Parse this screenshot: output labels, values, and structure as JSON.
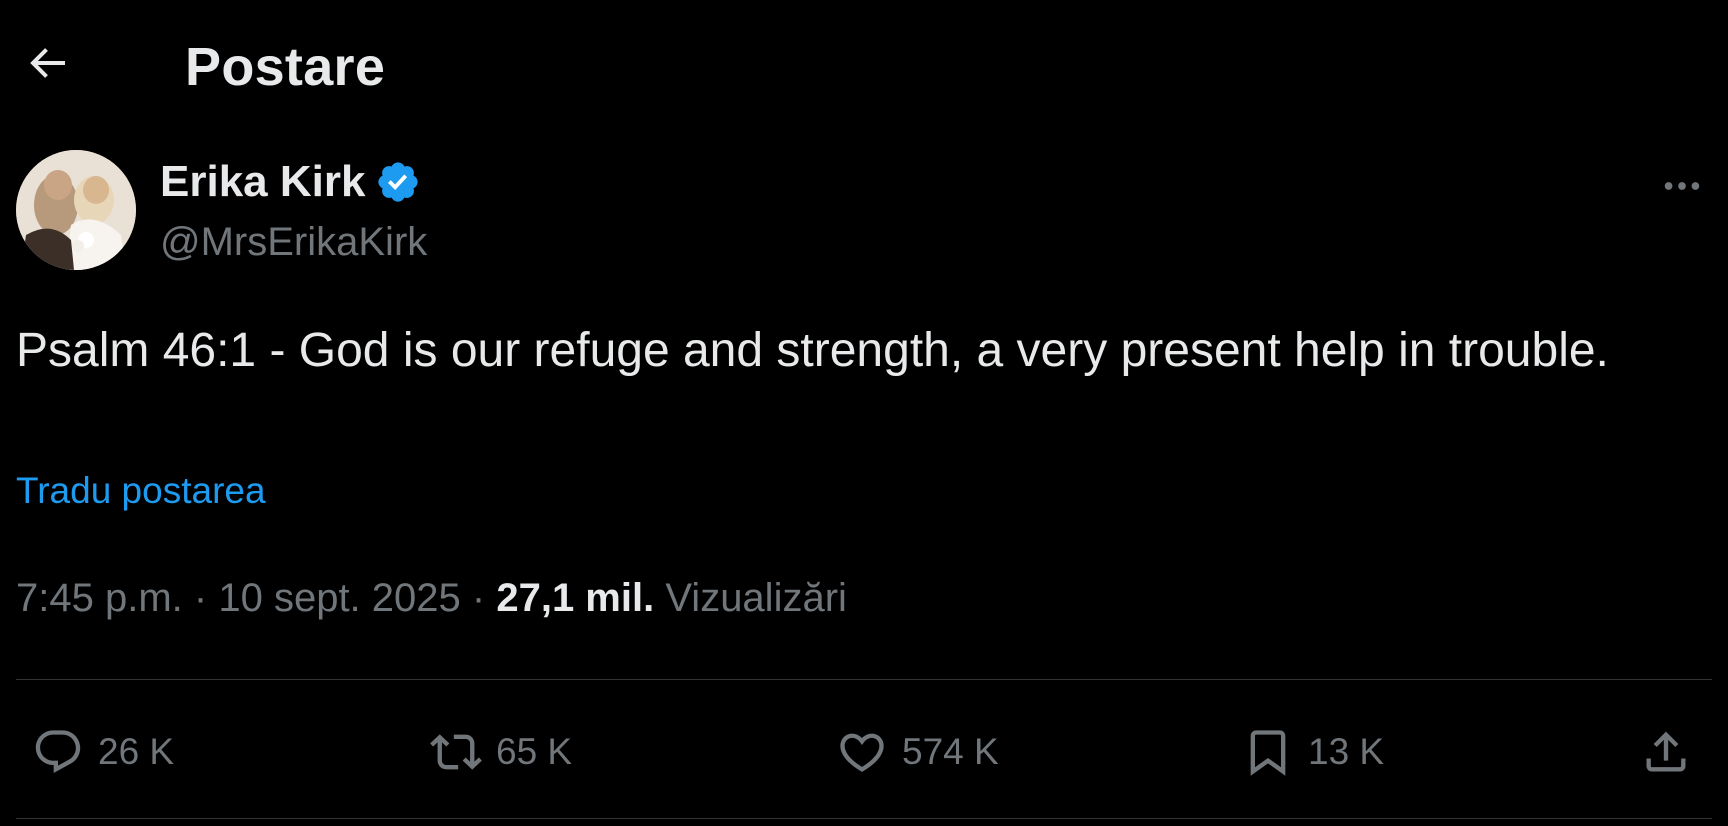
{
  "header": {
    "title": "Postare"
  },
  "author": {
    "display_name": "Erika Kirk",
    "handle": "@MrsErikaKirk",
    "verified": true
  },
  "post": {
    "text": "Psalm 46:1 - God is our refuge and strength, a very present help in trouble.",
    "translate_label": "Tradu postarea"
  },
  "meta": {
    "time": "7:45 p.m.",
    "separator": "·",
    "date": "10 sept. 2025",
    "views_count": "27,1 mil.",
    "views_label": "Vizualizări"
  },
  "actions": {
    "replies": "26 K",
    "reposts": "65 K",
    "likes": "574 K",
    "bookmarks": "13 K"
  },
  "colors": {
    "background": "#000000",
    "primary_text": "#e7e9ea",
    "secondary_text": "#71767b",
    "accent": "#1d9bf0",
    "divider": "#2f3336"
  }
}
